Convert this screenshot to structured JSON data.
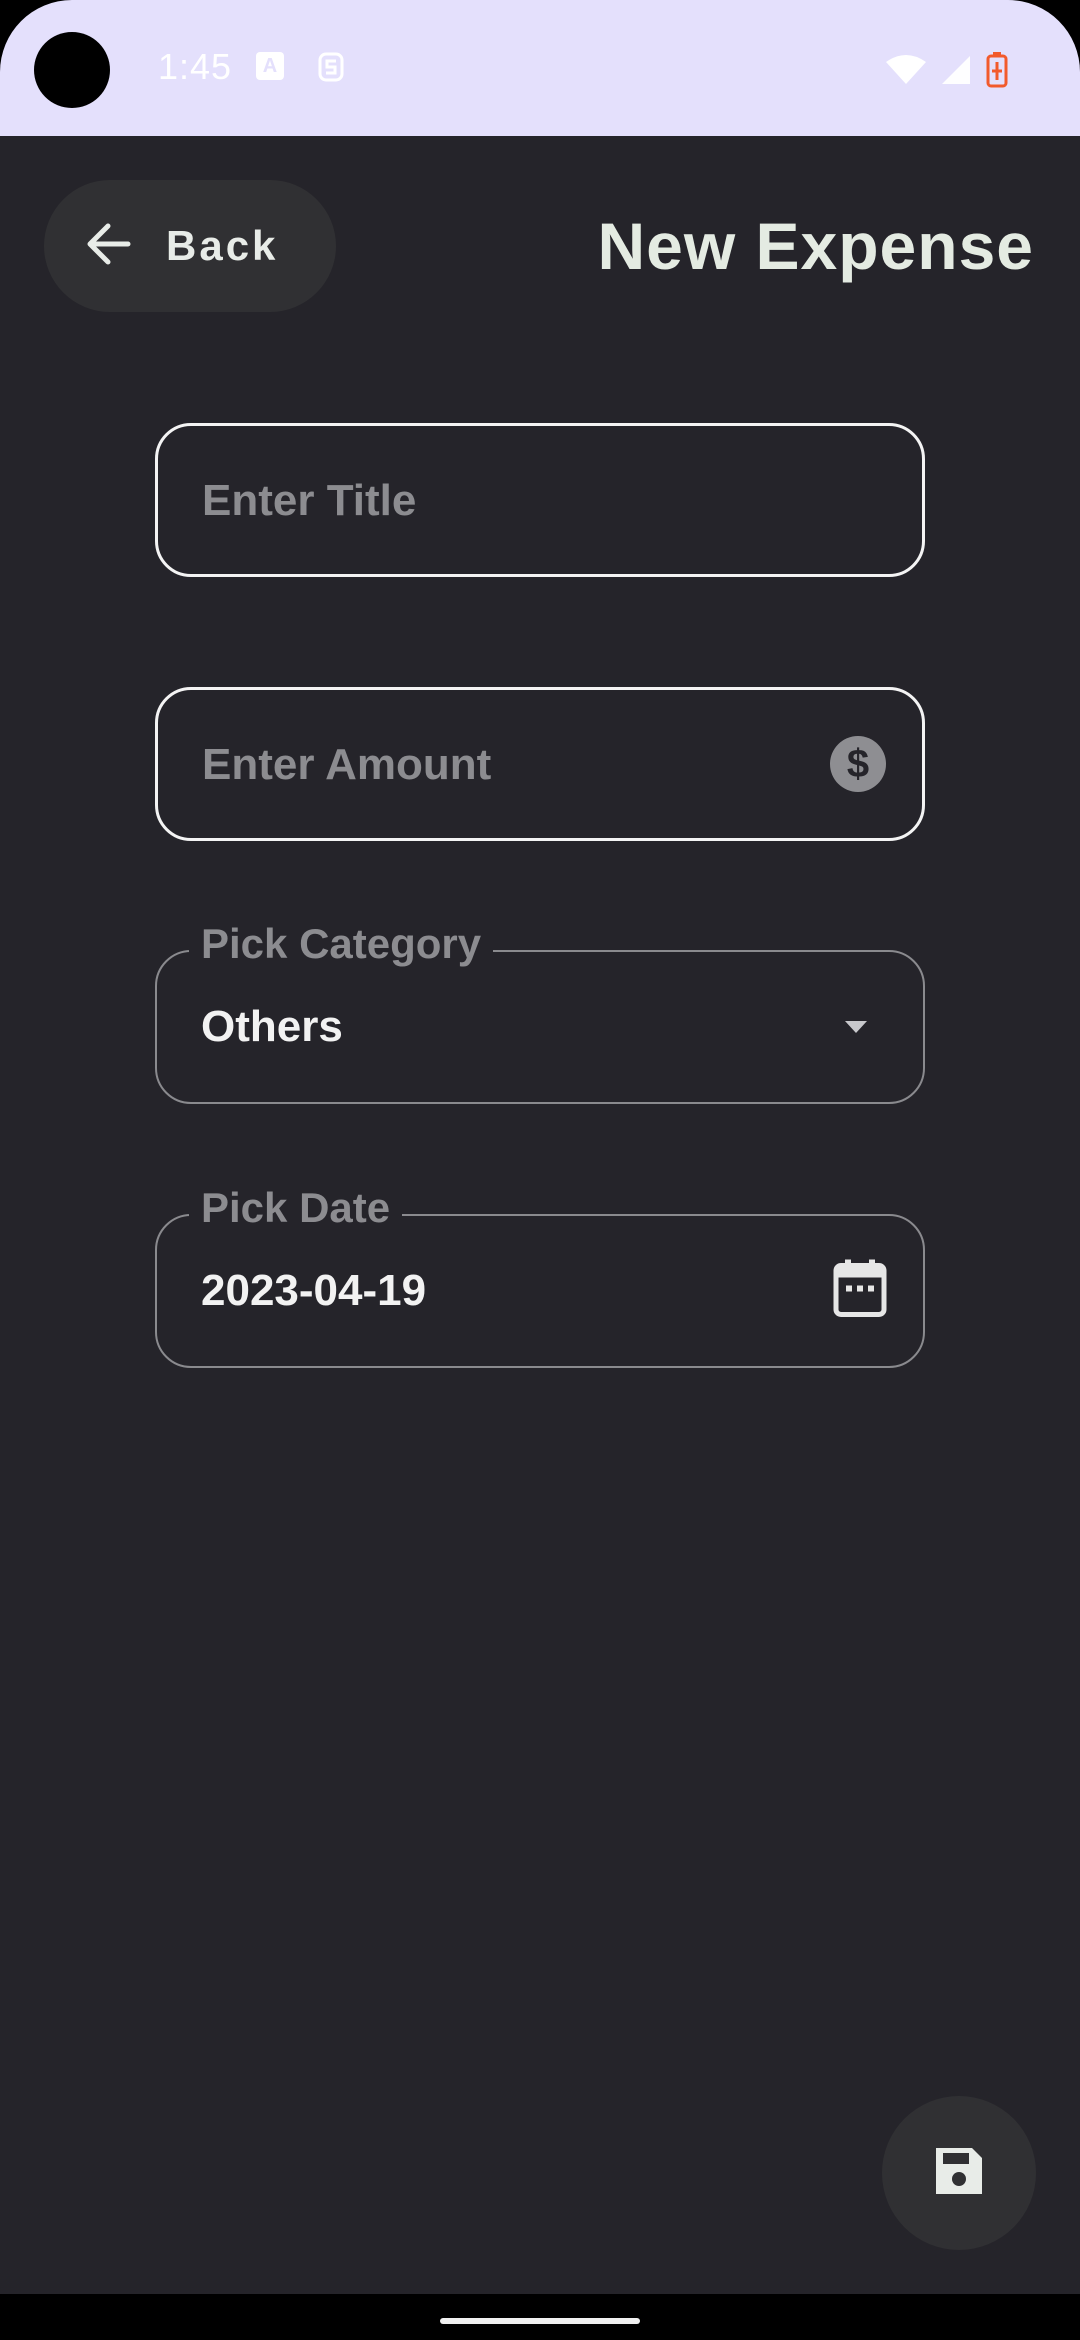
{
  "status_bar": {
    "time": "1:45",
    "icons": [
      "notification-a-icon",
      "notification-s-icon",
      "wifi-icon",
      "signal-icon",
      "battery-charging-icon"
    ]
  },
  "header": {
    "back_label": "Back",
    "title": "New Expense"
  },
  "form": {
    "title_field": {
      "placeholder": "Enter Title"
    },
    "amount_field": {
      "placeholder": "Enter Amount",
      "icon": "dollar-icon"
    },
    "category_field": {
      "label": "Pick Category",
      "value": "Others",
      "icon": "dropdown-arrow-icon"
    },
    "date_field": {
      "label": "Pick Date",
      "value": "2023-04-19",
      "icon": "calendar-icon"
    }
  },
  "fab": {
    "icon": "save-icon"
  },
  "colors": {
    "status_bar_bg": "#E4E0FC",
    "app_bg": "#25242A",
    "button_bg": "#303033",
    "text_primary": "#E4EBE2",
    "text_muted": "#8C8C90",
    "battery": "#F25A2C"
  }
}
